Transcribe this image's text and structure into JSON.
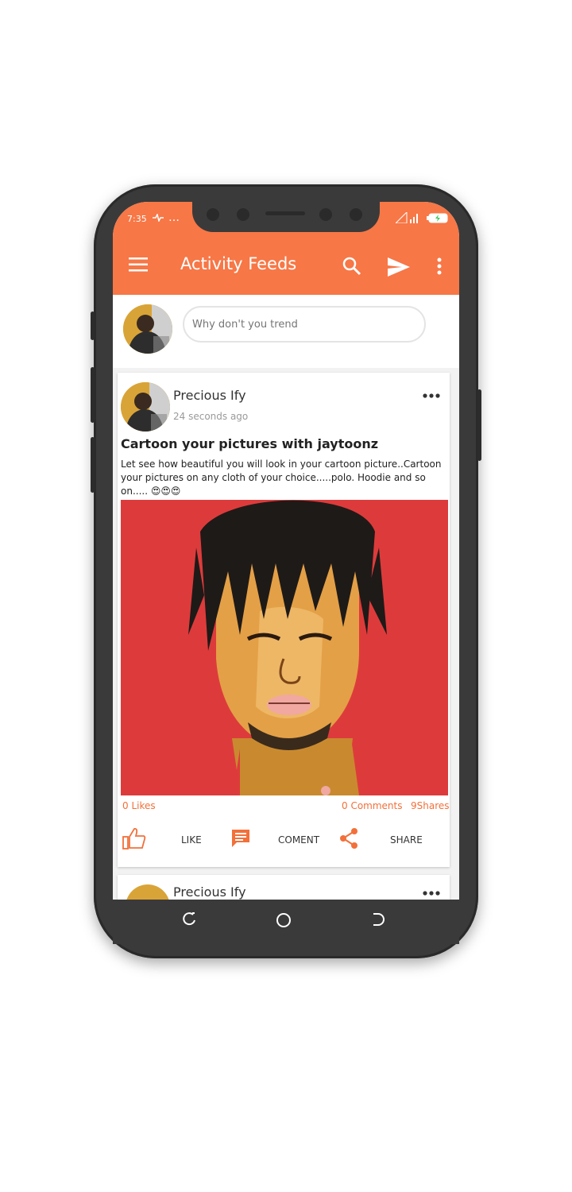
{
  "status_bar": {
    "time": "7:35",
    "extra": "…"
  },
  "app_bar": {
    "title": "Activity Feeds",
    "menu_icon": "hamburger-icon",
    "search_icon": "search-icon",
    "send_icon": "send-icon",
    "overflow_icon": "more-vert-icon"
  },
  "composer": {
    "placeholder": "Why don't you trend"
  },
  "posts": [
    {
      "author": "Precious Ify",
      "time_ago": "24 seconds ago",
      "title": "Cartoon your pictures with jaytoonz",
      "body": "Let see how beautiful you will look in your cartoon picture..Cartoon your pictures on any cloth of your choice.....polo. Hoodie and so on..... 😍😍😍",
      "likes": "0 Likes",
      "comments": "0 Comments",
      "shares": "9Shares",
      "actions": {
        "like": "LIKE",
        "comment": "COMENT",
        "share": "SHARE"
      }
    },
    {
      "author": "Precious Ify"
    }
  ],
  "colors": {
    "accent": "#f77746",
    "image_bg": "#dd3b3b",
    "phone_body": "#3a3a3a"
  }
}
